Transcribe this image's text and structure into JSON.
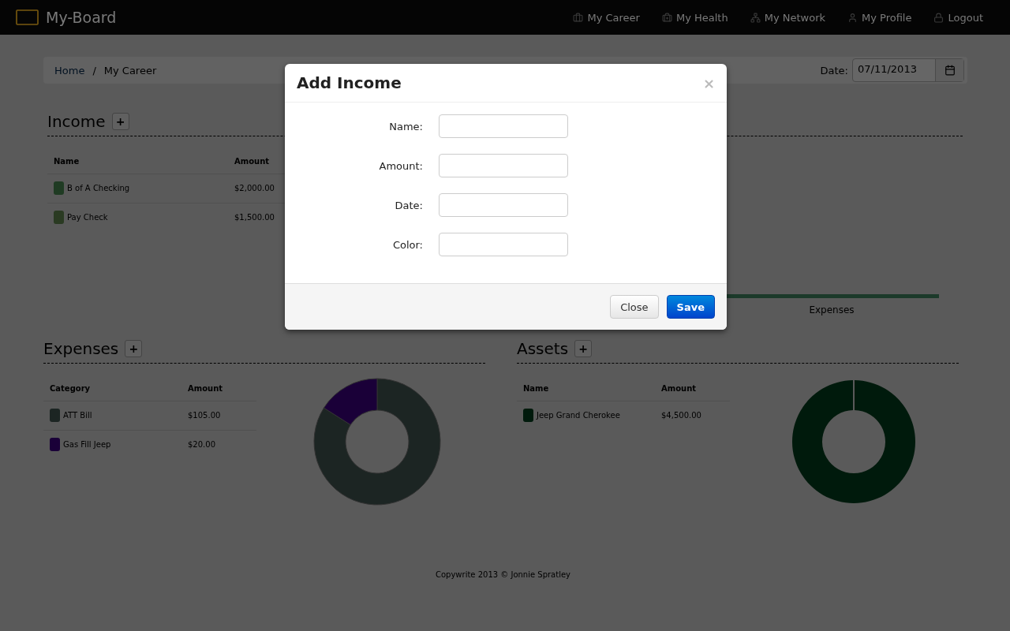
{
  "navbar": {
    "brand": "My-Board",
    "links": [
      {
        "kind": "career",
        "label": "My Career"
      },
      {
        "kind": "health",
        "label": "My Health"
      },
      {
        "kind": "network",
        "label": "My Network"
      },
      {
        "kind": "profile",
        "label": "My Profile"
      },
      {
        "kind": "logout",
        "label": "Logout"
      }
    ]
  },
  "breadcrumb": {
    "items": [
      "Home",
      "My Career"
    ],
    "separator": "/",
    "date_label": "Date:",
    "date_value": "07/11/2013"
  },
  "income": {
    "title": "Income",
    "add": "+",
    "columns": [
      "Name",
      "Amount"
    ],
    "rows": [
      {
        "name": "B of A Checking",
        "amount": "$2,000.00",
        "color": "#1f3b23"
      },
      {
        "name": "Pay Check",
        "amount": "$1,500.00",
        "color": "#2a3a22"
      }
    ],
    "chart_axis_label": "Expenses"
  },
  "expenses": {
    "title": "Expenses",
    "add": "+",
    "columns": [
      "Category",
      "Amount"
    ],
    "rows": [
      {
        "name": "ATT Bill",
        "amount": "$105.00",
        "color": "#1c2523"
      },
      {
        "name": "Gas Fill Jeep",
        "amount": "$20.00",
        "color": "#1a0038"
      }
    ],
    "chart_data": {
      "type": "donut",
      "values": [
        84,
        16
      ]
    }
  },
  "assets": {
    "title": "Assets",
    "add": "+",
    "columns": [
      "Name",
      "Amount"
    ],
    "rows": [
      {
        "name": "Jeep Grand Cherokee",
        "amount": "$4,500.00",
        "color": "#001a0c"
      }
    ]
  },
  "footer": "Copywrite 2013 © Jonnie Spratley",
  "modal": {
    "title": "Add Income",
    "close_glyph": "×",
    "fields": [
      {
        "label": "Name:"
      },
      {
        "label": "Amount:"
      },
      {
        "label": "Date:"
      },
      {
        "label": "Color:"
      }
    ],
    "buttons": [
      {
        "kind": "default",
        "label": "Close"
      },
      {
        "kind": "primary",
        "label": "Save"
      }
    ]
  }
}
